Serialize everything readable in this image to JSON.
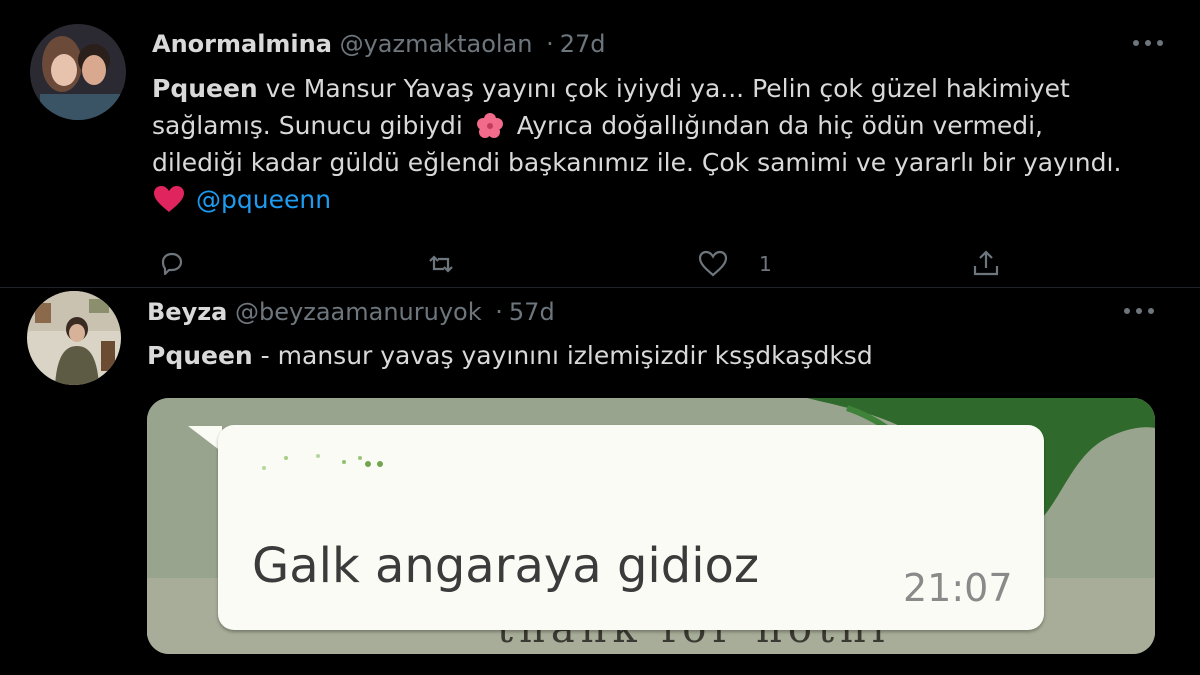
{
  "tweets": [
    {
      "display_name": "Anormalmina",
      "handle": "@yazmaktaolan",
      "separator": "·",
      "age": "27d",
      "tag": "Pqueen",
      "lines": [
        " ve Mansur Yavaş yayını çok iyiydi ya... Pelin çok güzel hakimiyet",
        "sağlamış. Sunucu gibiydi",
        "Ayrıca doğallığından da hiç ödün vermedi,",
        "dilediği kadar güldü eğlendi başkanımız ile. Çok samimi ve yararlı bir yayındı."
      ],
      "mention": "@pqueenn",
      "like_count": "1",
      "icons": [
        "reply-icon",
        "retweet-icon",
        "like-icon",
        "share-icon",
        "more-icon",
        "hibiscus-emoji",
        "heart-emoji"
      ],
      "colors": {
        "heart": "#e0245e",
        "hibiscus": "#f26b8a"
      }
    },
    {
      "display_name": "Beyza",
      "handle": "@beyzaamanuruyok",
      "separator": "·",
      "age": "57d",
      "tag": "Pqueen",
      "text": " - mansur yavaş yayınını izlemişizdir ksşdkaşdksd",
      "media": {
        "chat_message": "Galk angaraya gidioz",
        "chat_time": "21:07",
        "background_text": "thank  for  nothi"
      }
    }
  ],
  "colors": {
    "background": "#000000",
    "text": "#d9d9d9",
    "secondary": "#6e767d",
    "link": "#1d9bf0"
  }
}
